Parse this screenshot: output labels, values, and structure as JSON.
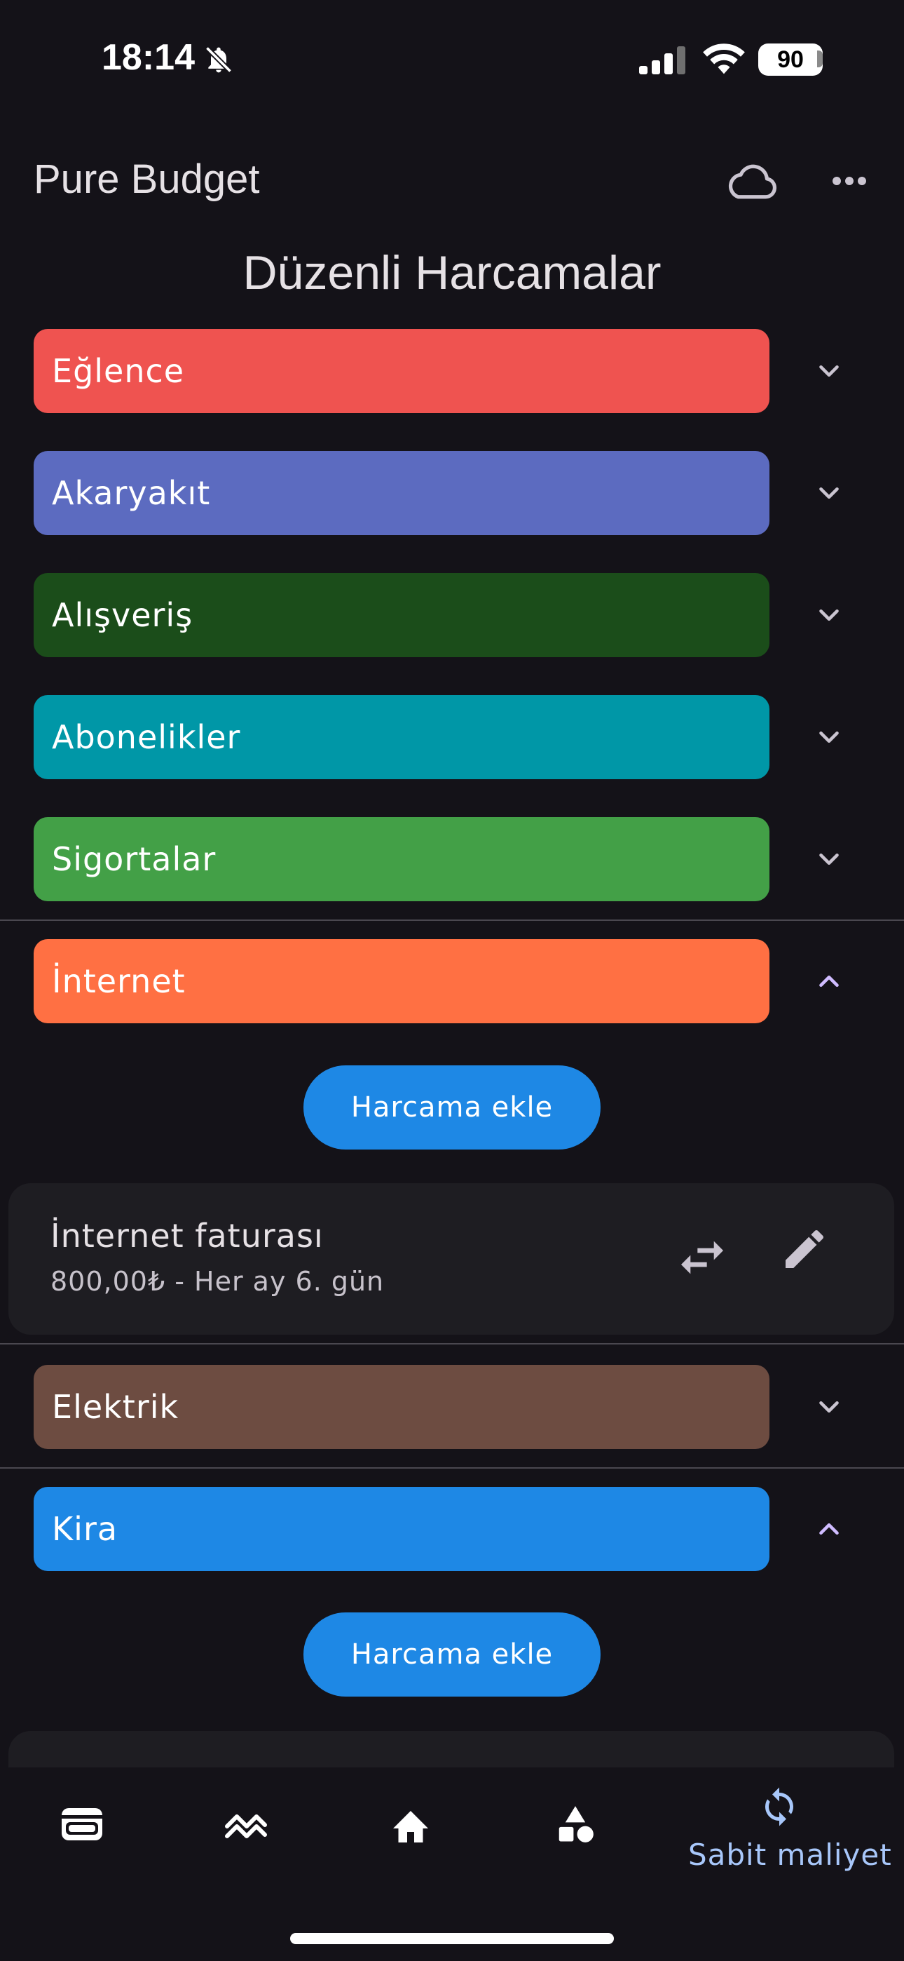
{
  "status_bar": {
    "time": "18:14",
    "battery": "90"
  },
  "app_bar": {
    "title": "Pure Budget",
    "icons": [
      "cloud-icon",
      "more-horiz-icon"
    ]
  },
  "page": {
    "title": "Düzenli Harcamalar"
  },
  "categories": [
    {
      "name": "Eğlence",
      "color": "#ef5350",
      "expanded": false
    },
    {
      "name": "Akaryakıt",
      "color": "#5c6bc0",
      "expanded": false
    },
    {
      "name": "Alışveriş",
      "color": "#1b4d1a",
      "expanded": false
    },
    {
      "name": "Abonelikler",
      "color": "#0097a7",
      "expanded": false
    },
    {
      "name": "Sigortalar",
      "color": "#43a047",
      "expanded": false
    },
    {
      "name": "İnternet",
      "color": "#ff7043",
      "expanded": true
    },
    {
      "name": "Elektrik",
      "color": "#6d4c41",
      "expanded": false
    },
    {
      "name": "Kira",
      "color": "#1e88e5",
      "expanded": true
    }
  ],
  "add_expense_label": "Harcama ekle",
  "expenses": {
    "internet": {
      "name": "İnternet faturası",
      "detail": "800,00₺ - Her ay 6. gün"
    }
  },
  "bottom_nav": {
    "items": [
      "wallet-icon",
      "trend-icon",
      "home-icon",
      "category-icon",
      "recurring-icon"
    ],
    "active_label": "Sabit maliyet",
    "active_color": "#a8c7fa"
  }
}
